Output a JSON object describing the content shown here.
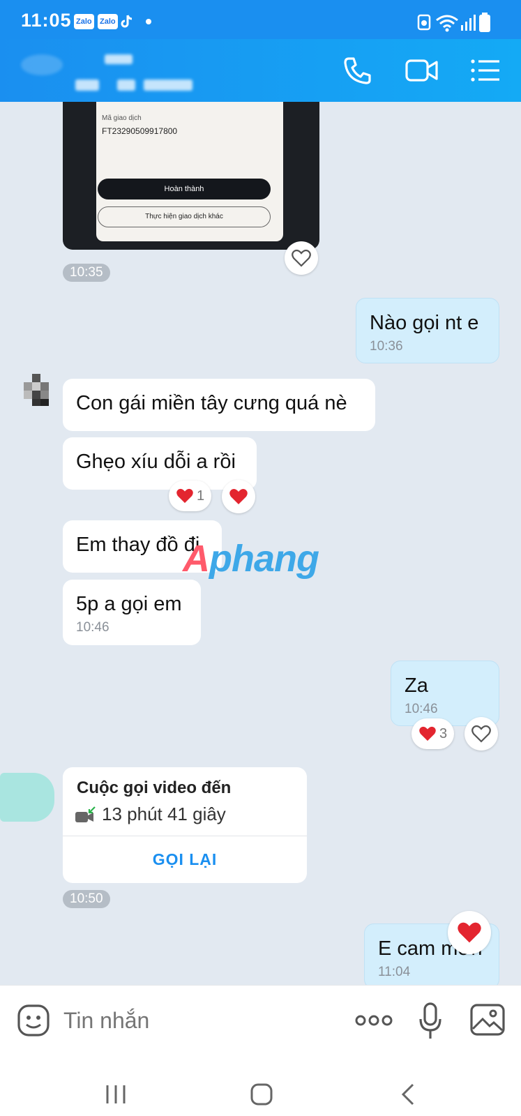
{
  "status_bar": {
    "time": "11:05",
    "app_badges": [
      "Zalo",
      "Zalo"
    ]
  },
  "photo_message": {
    "label": "Mã giao dịch",
    "code": "FT23290509917800",
    "primary_button": "Hoàn thành",
    "secondary_button": "Thực hiện giao dịch khác",
    "time": "10:35"
  },
  "messages": [
    {
      "side": "out",
      "text": "Nào gọi nt e",
      "time": "10:36"
    },
    {
      "side": "in",
      "text": "Con gái miền tây cưng quá nè"
    },
    {
      "side": "in",
      "text": "Ghẹo xíu dỗi a rồi",
      "reaction_count": "1"
    },
    {
      "side": "in",
      "text": "Em thay đồ đi"
    },
    {
      "side": "in",
      "text": "5p a gọi em",
      "time": "10:46"
    },
    {
      "side": "out",
      "text": "Za",
      "time": "10:46",
      "reaction_count": "3"
    },
    {
      "side": "out",
      "text": "E cam mơn",
      "time": "11:04"
    }
  ],
  "call_card": {
    "title": "Cuộc gọi video đến",
    "duration": "13 phút 41 giây",
    "action": "GỌI LẠI",
    "time": "10:50"
  },
  "watermark": {
    "part1": "A",
    "part2": "phang"
  },
  "input": {
    "placeholder": "Tin nhắn"
  },
  "colors": {
    "header": "#1a8ff0",
    "outgoing_bubble": "#d3eefc",
    "background": "#e2e9f1",
    "heart": "#e3252f"
  }
}
